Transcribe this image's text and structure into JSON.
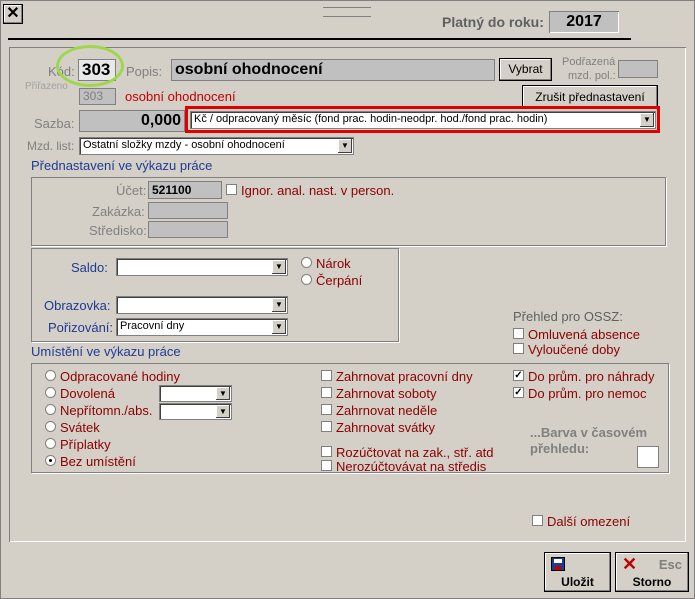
{
  "window": {
    "close_glyph": "✕",
    "valid_year_label": "Platný do roku:",
    "valid_year_value": "2017"
  },
  "header": {
    "code_label": "Kód:",
    "code_value": "303",
    "desc_label": "Popis:",
    "desc_value": "osobní ohodnocení",
    "select_button": "Vybrat",
    "parent_label_1": "Podřazená",
    "parent_label_2": "mzd. pol.:",
    "assigned_label": "Přiřazeno",
    "assigned_code": "303",
    "assigned_desc": "osobní ohodnocení",
    "cancel_preset_button": "Zrušit přednastavení",
    "rate_label": "Sazba:",
    "rate_value": "0,000",
    "rate_unit_value": "Kč / odpracovaný měsíc (fond prac. hodin-neodpr. hod./fond prac. hodin)",
    "wage_list_label": "Mzd. list:",
    "wage_list_value": "Ostatní složky mzdy - osobní ohodnocení"
  },
  "preset": {
    "title": "Přednastavení ve výkazu práce",
    "account_label": "Účet:",
    "account_value": "521100",
    "ignore_label": "Ignor. anal. nast. v person.",
    "order_label": "Zakázka:",
    "center_label": "Středisko:"
  },
  "balance": {
    "saldo_label": "Saldo:",
    "claim_label": "Nárok",
    "draw_label": "Čerpání",
    "screen_label": "Obrazovka:",
    "entry_label": "Pořizování:",
    "entry_value": "Pracovní dny"
  },
  "ossz": {
    "title": "Přehled pro OSSZ:",
    "excused_label": "Omluvená absence",
    "excluded_label": "Vyloučené doby"
  },
  "placement": {
    "title": "Umístění ve výkazu práce",
    "radios": [
      "Odpracované hodiny",
      "Dovolená",
      "Nepřítomn./abs.",
      "Svátek",
      "Příplatky",
      "Bez umístění"
    ],
    "selected_index": 5,
    "checks_mid": [
      "Zahrnovat pracovní dny",
      "Zahrnovat soboty",
      "Zahrnovat neděle",
      "Zahrnovat svátky"
    ],
    "checks_mid2": [
      "Rozúčtovat na zak., stř. atd",
      "Nerozúčtovávat na středis"
    ],
    "avg_comp_label": "Do prům. pro náhrady",
    "avg_sick_label": "Do prům. pro nemoc",
    "color_label_1": "...Barva v časovém",
    "color_label_2": "přehledu:",
    "more_limits_label": "Další omezení"
  },
  "footer": {
    "save_label": "Uložit",
    "cancel_label": "Storno",
    "esc_label": "Esc"
  },
  "colors": {
    "highlight_red": "#e00000",
    "highlight_green": "#9ed84a",
    "label_red": "#8b0000",
    "label_navy": "#1f3a93"
  }
}
